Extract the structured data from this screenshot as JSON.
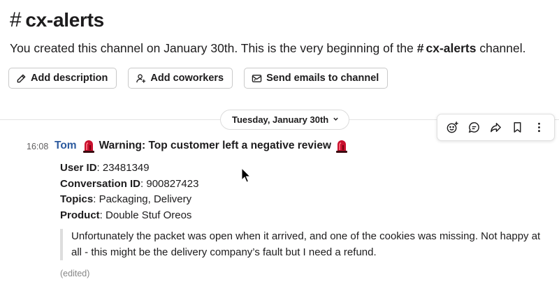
{
  "channel": {
    "hash": "#",
    "name": "cx-alerts",
    "intro_before": "You created this channel on January 30th. This is the very beginning of the ",
    "intro_hash": "#",
    "intro_channel": "cx-alerts",
    "intro_after": " channel."
  },
  "actions": {
    "add_description": "Add description",
    "add_coworkers": "Add coworkers",
    "send_emails": "Send emails to channel"
  },
  "date_divider": {
    "label": "Tuesday, January 30th",
    "chevron": "⌄"
  },
  "toolbar": {
    "icons": [
      "add-reaction-icon",
      "reply-in-thread-icon",
      "forward-icon",
      "bookmark-icon",
      "more-actions-icon"
    ]
  },
  "message": {
    "time": "16:08",
    "author": "Tom",
    "headline": "Warning: Top customer left a negative review",
    "fields": [
      {
        "label": "User ID",
        "value": "23481349"
      },
      {
        "label": "Conversation ID",
        "value": "900827423"
      },
      {
        "label": "Topics",
        "value": "Packaging, Delivery"
      },
      {
        "label": "Product",
        "value": "Double Stuf Oreos"
      }
    ],
    "separator": ": ",
    "quote": "Unfortunately the packet was open when it arrived, and one of the cookies was missing. Not happy at all - this might be the delivery company’s fault but I need a refund.",
    "edited": "(edited)"
  },
  "colors": {
    "author": "#2c5a9e",
    "siren_red": "#c8102e",
    "quote_bar": "#dddddd"
  }
}
